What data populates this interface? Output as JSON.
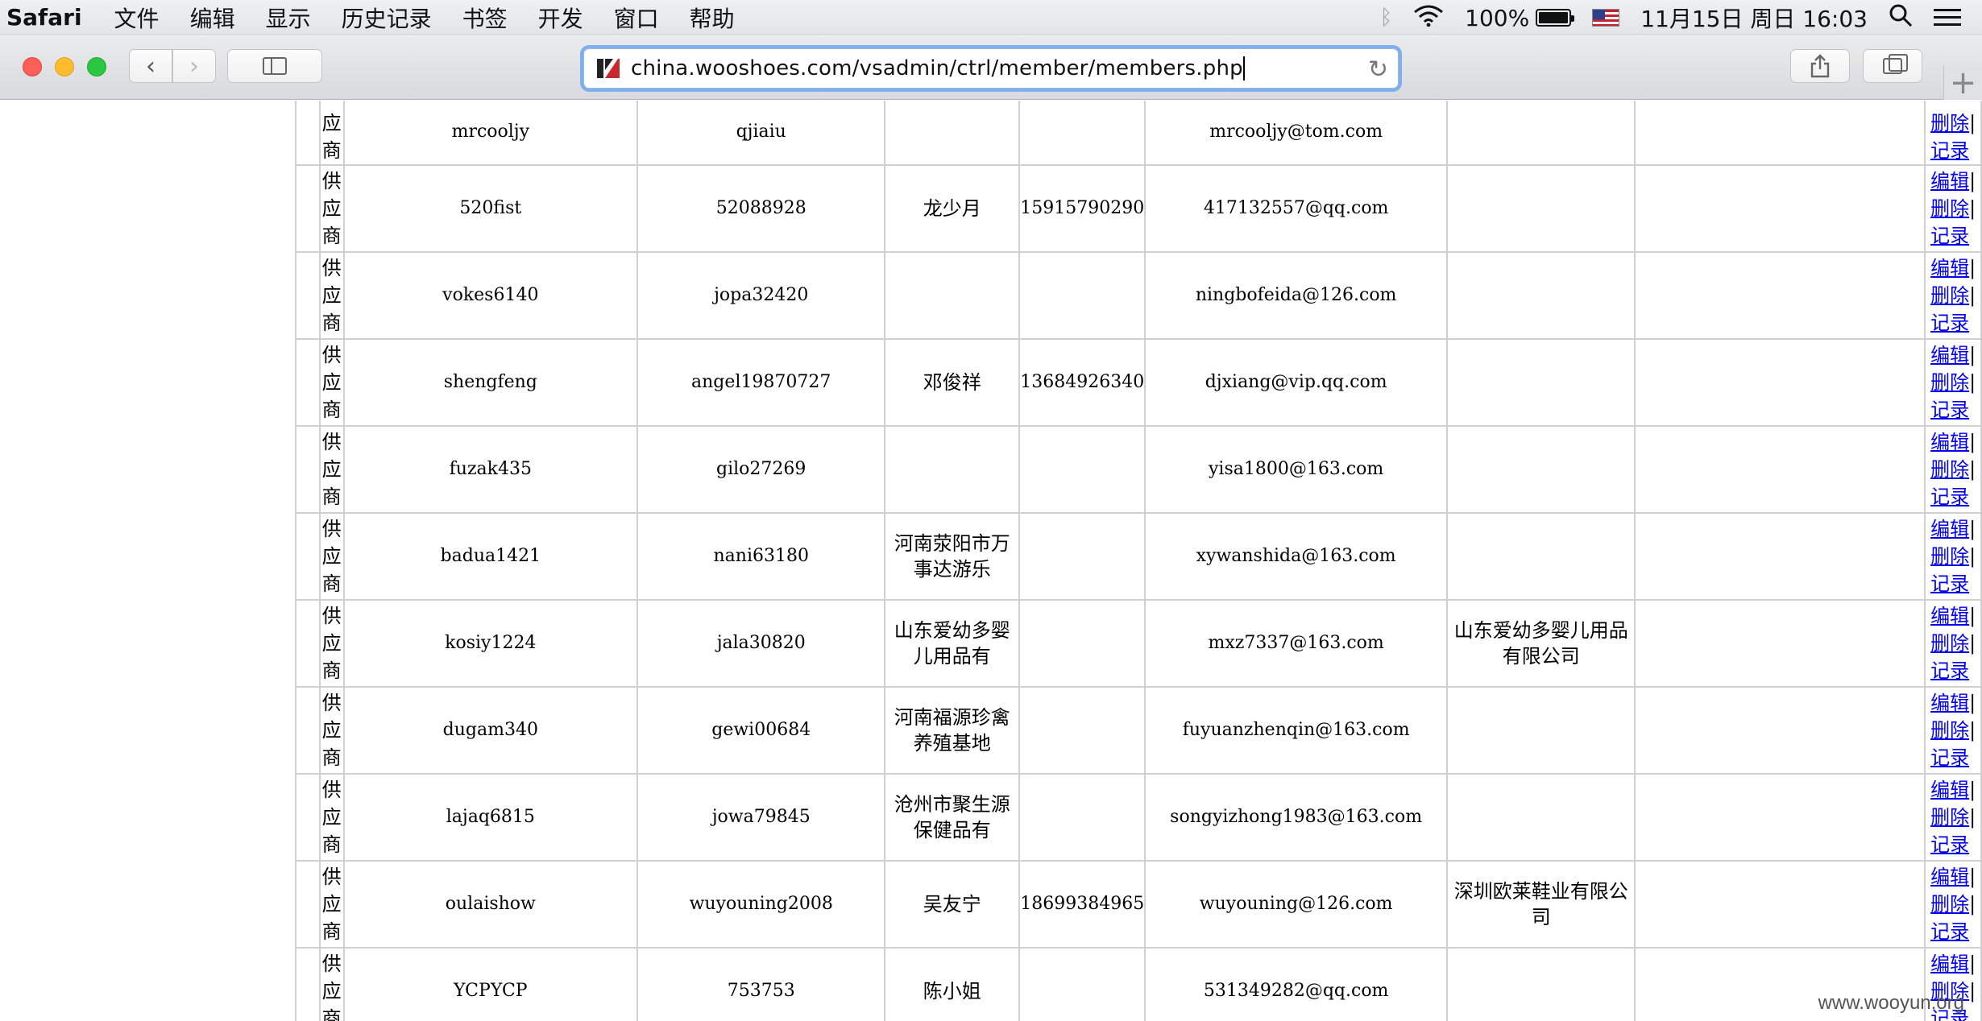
{
  "menubar": {
    "app_name": "Safari",
    "menus": [
      "文件",
      "编辑",
      "显示",
      "历史记录",
      "书签",
      "开发",
      "窗口",
      "帮助"
    ],
    "battery": "100%",
    "battery_level_percent": 100,
    "datetime": "11月15日 周日  16:03",
    "icons": [
      "bluetooth-icon",
      "wifi-icon",
      "battery-icon",
      "us-flag-icon",
      "spotlight-icon",
      "notification-list-icon"
    ]
  },
  "toolbar": {
    "url": "china.wooshoes.com/vsadmin/ctrl/member/members.php",
    "back_glyph": "‹",
    "forward_glyph": "›",
    "new_tab_glyph": "+"
  },
  "table": {
    "op_labels": {
      "edit": "编辑",
      "delete": "删除",
      "log": "记录",
      "sep": "|"
    },
    "rows": [
      {
        "type": "应商",
        "username": "mrcooljy",
        "password": "qjiaiu",
        "name": "",
        "phone": "",
        "email": "mrcooljy@tom.com",
        "company": "",
        "extra": "",
        "ops_partial": true
      },
      {
        "type": "供应商",
        "username": "520fist",
        "password": "52088928",
        "name": "龙少月",
        "phone": "15915790290",
        "email": "417132557@qq.com",
        "company": "",
        "extra": ""
      },
      {
        "type": "供应商",
        "username": "vokes6140",
        "password": "jopa32420",
        "name": "",
        "phone": "",
        "email": "ningbofeida@126.com",
        "company": "",
        "extra": ""
      },
      {
        "type": "供应商",
        "username": "shengfeng",
        "password": "angel19870727",
        "name": "邓俊祥",
        "phone": "13684926340",
        "email": "djxiang@vip.qq.com",
        "company": "",
        "extra": ""
      },
      {
        "type": "供应商",
        "username": "fuzak435",
        "password": "gilo27269",
        "name": "",
        "phone": "",
        "email": "yisa1800@163.com",
        "company": "",
        "extra": ""
      },
      {
        "type": "供应商",
        "username": "badua1421",
        "password": "nani63180",
        "name": "河南荥阳市万事达游乐",
        "phone": "",
        "email": "xywanshida@163.com",
        "company": "",
        "extra": ""
      },
      {
        "type": "供应商",
        "username": "kosiy1224",
        "password": "jala30820",
        "name": "山东爱幼多婴儿用品有",
        "phone": "",
        "email": "mxz7337@163.com",
        "company": "山东爱幼多婴儿用品有限公司",
        "extra": ""
      },
      {
        "type": "供应商",
        "username": "dugam340",
        "password": "gewi00684",
        "name": "河南福源珍禽养殖基地",
        "phone": "",
        "email": "fuyuanzhenqin@163.com",
        "company": "",
        "extra": ""
      },
      {
        "type": "供应商",
        "username": "lajaq6815",
        "password": "jowa79845",
        "name": "沧州市聚生源保健品有",
        "phone": "",
        "email": "songyizhong1983@163.com",
        "company": "",
        "extra": ""
      },
      {
        "type": "供应商",
        "username": "oulaishow",
        "password": "wuyouning2008",
        "name": "吴友宁",
        "phone": "18699384965",
        "email": "wuyouning@126.com",
        "company": "深圳欧莱鞋业有限公司",
        "extra": ""
      },
      {
        "type": "供应商",
        "username": "YCPYCP",
        "password": "753753",
        "name": "陈小姐",
        "phone": "",
        "email": "531349282@qq.com",
        "company": "",
        "extra": ""
      }
    ]
  },
  "watermark": "www.wooyun.org"
}
